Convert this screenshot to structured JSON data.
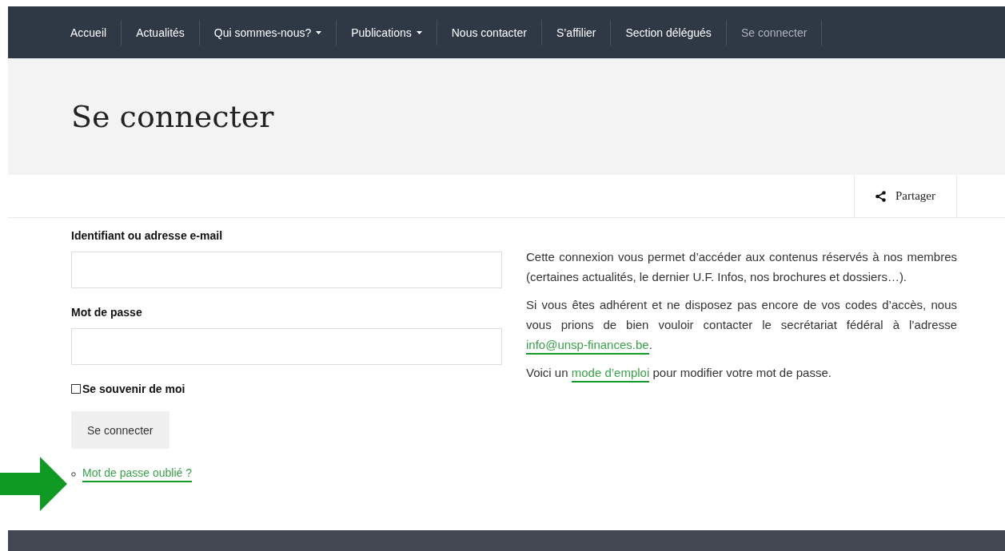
{
  "nav": [
    {
      "label": "Accueil",
      "dropdown": false,
      "selected": false
    },
    {
      "label": "Actualités",
      "dropdown": false,
      "selected": false
    },
    {
      "label": "Qui sommes-nous?",
      "dropdown": true,
      "selected": false
    },
    {
      "label": "Publications",
      "dropdown": true,
      "selected": false
    },
    {
      "label": "Nous contacter",
      "dropdown": false,
      "selected": false
    },
    {
      "label": "S’affilier",
      "dropdown": false,
      "selected": false
    },
    {
      "label": "Section délégués",
      "dropdown": false,
      "selected": false
    },
    {
      "label": "Se connecter",
      "dropdown": false,
      "selected": true
    }
  ],
  "page_title": "Se connecter",
  "share": {
    "label": "Partager"
  },
  "form": {
    "fields": [
      {
        "label": "Identifiant ou adresse e-mail"
      },
      {
        "label": "Mot de passe"
      }
    ],
    "remember": {
      "label": "Se souvenir de moi",
      "checked": false
    },
    "submit": "Se connecter",
    "forgot_link": "Mot de passe oublié ?"
  },
  "info": [
    {
      "segments": [
        {
          "kind": "text",
          "text": "Cette connexion vous permet d’accéder aux contenus réservés à nos membres (certaines actualités, le dernier U.F. Infos, nos brochures et dossiers…)."
        }
      ]
    },
    {
      "segments": [
        {
          "kind": "text",
          "text": "Si vous êtes adhérent et ne disposez pas encore de vos codes d’accès, nous vous prions de bien vouloir contacter le secrétariat fédéral à l’adresse "
        },
        {
          "kind": "link",
          "text": "info@unsp-finances.be"
        },
        {
          "kind": "text",
          "text": "."
        }
      ]
    },
    {
      "segments": [
        {
          "kind": "text",
          "text": "Voici un "
        },
        {
          "kind": "link",
          "text": "mode d’emploi"
        },
        {
          "kind": "text",
          "text": " pour modifier votre mot de passe."
        }
      ]
    }
  ]
}
